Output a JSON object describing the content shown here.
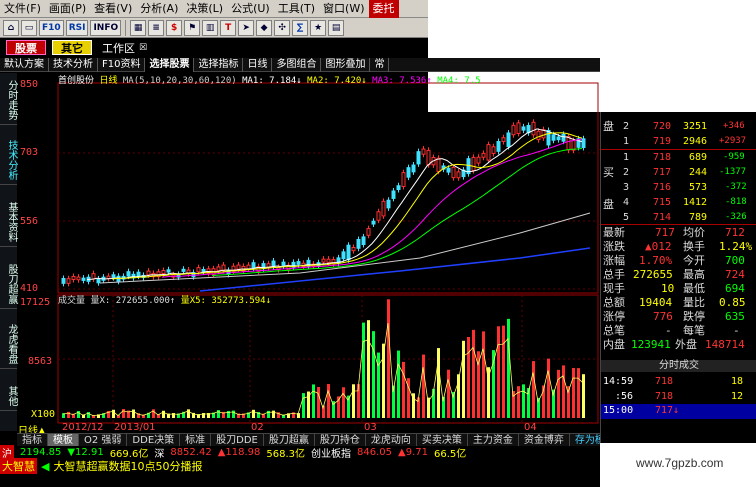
{
  "menubar": {
    "items": [
      "文件(F)",
      "画面(P)",
      "查看(V)",
      "分析(A)",
      "决策(L)",
      "公式(U)",
      "工具(T)",
      "窗口(W)",
      "委托"
    ]
  },
  "toolbar": {
    "buttons": [
      "F10",
      "RSI",
      "INFO",
      "$",
      "T",
      "∑"
    ]
  },
  "modules": {
    "stock": "股票",
    "other": "其它",
    "workarea": "工作区",
    "close": "☒"
  },
  "functabs": [
    "默认方案",
    "技术分析",
    "F10资料",
    "选择股票",
    "选择指标",
    "日线",
    "多图组合",
    "图形叠加",
    "常"
  ],
  "sidetabs": [
    "分时走势",
    "技术分析",
    "基本资料",
    "股刀超赢",
    "龙虎看盘",
    "其他"
  ],
  "price_pane": {
    "stock_name": "首创股份",
    "period": "日线",
    "ma_text": "MA(5,10,20,30,60,120)",
    "ma1": "MA1: 7.184↓",
    "ma2": "MA2: 7.420↓",
    "ma3": "MA3: 7.536↑",
    "ma4": "MA4: 7.5",
    "y_labels": [
      "850",
      "703",
      "556",
      "410"
    ]
  },
  "volume_pane": {
    "title": "成交量",
    "vol": "量X: 272655.000↑",
    "vol5": "量X5: 352773.594↓",
    "y_labels": [
      "17125",
      "8563"
    ],
    "unit": "X100"
  },
  "x_axis": {
    "labels": [
      "2012/12",
      "2013/01",
      "02",
      "03",
      "04"
    ]
  },
  "period_label": "日线▲",
  "bottom_tabs": [
    "指标",
    "模板",
    "O2 强弱",
    "DDE决策",
    "标准",
    "股刀DDE",
    "股刀超赢",
    "股刀持仓",
    "龙虎动向",
    "买卖决策",
    "主力资金",
    "资金博弈",
    "存为模板"
  ],
  "ticker": {
    "market1": "沪",
    "idx1": "2194.85",
    "chg1": "▼12.91",
    "amt1": "669.6亿",
    "market2": "深",
    "idx2": "8852.42",
    "chg2": "▲118.98",
    "amt2": "568.3亿",
    "market3": "创业板指",
    "idx3": "846.05",
    "chg3": "▲9.71",
    "amt3": "66.5亿"
  },
  "status": {
    "badge": "大智慧",
    "text": "大智慧超赢数据10点50分播报"
  },
  "quote": {
    "asks": [
      {
        "level": "2",
        "price": "720",
        "vol": "3251",
        "chg": "+346"
      },
      {
        "level": "1",
        "price": "719",
        "vol": "2946",
        "chg": "+2937"
      }
    ],
    "bids": [
      {
        "level": "1",
        "price": "718",
        "vol": "689",
        "chg": "-959"
      },
      {
        "level": "2",
        "price": "717",
        "vol": "244",
        "chg": "-1377"
      },
      {
        "level": "3",
        "price": "716",
        "vol": "573",
        "chg": "-372"
      },
      {
        "level": "4",
        "price": "715",
        "vol": "1412",
        "chg": "-818"
      },
      {
        "level": "5",
        "price": "714",
        "vol": "789",
        "chg": "-326"
      }
    ],
    "sell_label": "盘",
    "buy_label1": "买",
    "buy_label2": "盘",
    "latest_label": "最新",
    "latest": "717",
    "avg_label": "均价",
    "avg": "712",
    "chg_label": "涨跌",
    "chg": "▲012",
    "turn_label": "换手",
    "turn": "1.24%",
    "pct_label": "涨幅",
    "pct": "1.70%",
    "open_label": "今开",
    "open": "700",
    "total_label": "总手",
    "total": "272655",
    "high_label": "最高",
    "high": "724",
    "cur_label": "现手",
    "cur": "10",
    "low_label": "最低",
    "low": "694",
    "amount_label": "总额",
    "amount": "19404",
    "ratio_label": "量比",
    "ratio": "0.85",
    "limitup_label": "涨停",
    "limitup": "776",
    "limitdn_label": "跌停",
    "limitdn": "635",
    "trades_label": "总笔",
    "per_label": "每笔",
    "inner_label": "内盘",
    "inner": "123941",
    "outer_label": "外盘",
    "outer": "148714"
  },
  "trades": {
    "header": "分时成交",
    "rows": [
      {
        "time": "14:59",
        "price": "718",
        "vol": "18"
      },
      {
        "time": ":56",
        "price": "718",
        "vol": "12"
      },
      {
        "time": "15:00",
        "price": "717↓",
        "vol": ""
      }
    ]
  },
  "watermark": "www.7gpzb.com",
  "colors": {
    "up": "#ff3030",
    "down": "#00ff40",
    "yellow": "#ffff00",
    "cyan": "#40e0ff"
  }
}
